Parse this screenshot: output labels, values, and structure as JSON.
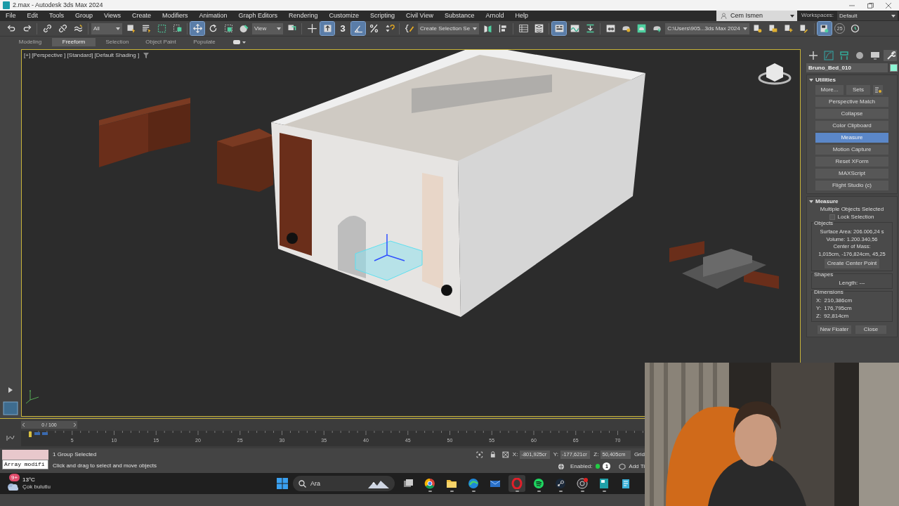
{
  "window": {
    "title": "2.max - Autodesk 3ds Max 2024"
  },
  "menu_bar": [
    "File",
    "Edit",
    "Tools",
    "Group",
    "Views",
    "Create",
    "Modifiers",
    "Animation",
    "Graph Editors",
    "Rendering",
    "Customize",
    "Scripting",
    "Civil View",
    "Substance",
    "Arnold",
    "Help"
  ],
  "user": {
    "name": "Cem Ismen"
  },
  "workspaces": {
    "label": "Workspaces:",
    "value": "Default"
  },
  "toolbar": [
    {
      "kind": "undo",
      "selected": false
    },
    {
      "kind": "redo",
      "selected": false
    },
    {
      "kind": "separator"
    },
    {
      "kind": "link",
      "selected": false
    },
    {
      "kind": "unlink",
      "selected": false
    },
    {
      "kind": "bind",
      "selected": false
    },
    {
      "kind": "separator"
    },
    {
      "kind": "dropdown",
      "value": "All"
    },
    {
      "kind": "select",
      "selected": false
    },
    {
      "kind": "select-by-name",
      "selected": false
    },
    {
      "kind": "region",
      "selected": false
    },
    {
      "kind": "crossing",
      "selected": false
    },
    {
      "kind": "separator"
    },
    {
      "kind": "move",
      "selected": true
    },
    {
      "kind": "rotate",
      "selected": false
    },
    {
      "kind": "scale",
      "selected": false
    },
    {
      "kind": "place",
      "selected": false
    },
    {
      "kind": "dropdown",
      "value": "View"
    },
    {
      "kind": "pivot",
      "selected": false
    },
    {
      "kind": "separator"
    },
    {
      "kind": "manipulate",
      "selected": false
    },
    {
      "kind": "keyboard",
      "selected": true
    },
    {
      "kind": "snap",
      "label": "3",
      "selected": false
    },
    {
      "kind": "angle-snap",
      "selected": true
    },
    {
      "kind": "percent-snap",
      "selected": false
    },
    {
      "kind": "spinner-snap",
      "selected": false
    },
    {
      "kind": "separator"
    },
    {
      "kind": "named-sets",
      "selected": false
    },
    {
      "kind": "dropdown",
      "value": "Create Selection Se"
    },
    {
      "kind": "mirror",
      "selected": false
    },
    {
      "kind": "align",
      "selected": false
    },
    {
      "kind": "separator"
    },
    {
      "kind": "explorer",
      "selected": false
    },
    {
      "kind": "layers",
      "selected": false
    },
    {
      "kind": "separator"
    },
    {
      "kind": "ribbon",
      "selected": true
    },
    {
      "kind": "curve-editor",
      "selected": false
    },
    {
      "kind": "schematic",
      "selected": false
    },
    {
      "kind": "separator"
    },
    {
      "kind": "material",
      "selected": false
    },
    {
      "kind": "render-setup",
      "selected": false
    },
    {
      "kind": "render-frame",
      "selected": false
    },
    {
      "kind": "render",
      "selected": false
    },
    {
      "kind": "dropdown",
      "value": "C:\\Users\\905...3ds Max 2024"
    },
    {
      "kind": "project",
      "selected": false
    },
    {
      "kind": "project-open",
      "selected": false
    },
    {
      "kind": "project-new",
      "selected": false
    },
    {
      "kind": "project-edit",
      "selected": false
    },
    {
      "kind": "separator"
    },
    {
      "kind": "autobackup",
      "selected": true
    },
    {
      "kind": "counter",
      "label": "25",
      "selected": false
    },
    {
      "kind": "history",
      "selected": false
    }
  ],
  "ribbon_tabs": [
    {
      "label": "Modeling",
      "selected": false
    },
    {
      "label": "Freeform",
      "selected": true
    },
    {
      "label": "Selection",
      "selected": false
    },
    {
      "label": "Object Paint",
      "selected": false
    },
    {
      "label": "Populate",
      "selected": false
    }
  ],
  "viewport": {
    "labels": [
      "[+]",
      "[Perspective ]",
      "[Standard]",
      "[Default Shading ]"
    ]
  },
  "command_panel": {
    "tabs": [
      {
        "kind": "create",
        "selected": false
      },
      {
        "kind": "modify",
        "selected": false
      },
      {
        "kind": "hierarchy",
        "selected": false
      },
      {
        "kind": "motion",
        "selected": false
      },
      {
        "kind": "display",
        "selected": false
      },
      {
        "kind": "utilities",
        "selected": true
      }
    ],
    "object_name": "Bruno_Bed_010",
    "color": "#8ef5d4",
    "utilities": {
      "title": "Utilities",
      "more": "More...",
      "sets": "Sets",
      "buttons": [
        {
          "label": "Perspective Match",
          "selected": false
        },
        {
          "label": "Collapse",
          "selected": false
        },
        {
          "label": "Color Clipboard",
          "selected": false
        },
        {
          "label": "Measure",
          "selected": true
        },
        {
          "label": "Motion Capture",
          "selected": false
        },
        {
          "label": "Reset XForm",
          "selected": false
        },
        {
          "label": "MAXScript",
          "selected": false
        },
        {
          "label": "Flight Studio (c)",
          "selected": false
        }
      ]
    },
    "measure": {
      "title": "Measure",
      "status": "Multiple Objects Selected",
      "lock_selection": {
        "label": "Lock Selection",
        "checked": false
      },
      "objects": {
        "title": "Objects",
        "lines": [
          "Surface Area: 206.006,24 s",
          "Volume: 1.200.340,56",
          "Center of Mass:",
          "1,015cm, -176,824cm, 45,25"
        ]
      },
      "create_center_point": "Create Center Point",
      "shapes": {
        "title": "Shapes",
        "length": "Length: ---"
      },
      "dimensions": {
        "title": "Dimensions",
        "lines": [
          {
            "axis": "X:",
            "value": "210,386cm"
          },
          {
            "axis": "Y:",
            "value": "176,795cm"
          },
          {
            "axis": "Z:",
            "value": "92,814cm"
          }
        ]
      },
      "new_floater": "New Floater",
      "close": "Close"
    }
  },
  "timeline": {
    "position": "0 / 100",
    "level": 0,
    "ticks": [
      "5",
      "10",
      "15",
      "20",
      "25",
      "30",
      "35",
      "40",
      "45",
      "50",
      "55",
      "60",
      "65",
      "70"
    ]
  },
  "status": {
    "listener": "Array modifi",
    "selection": "1 Group Selected",
    "prompt": "Click and drag to select and move objects",
    "coords": [
      {
        "axis": "X:",
        "value": "-801,925cr"
      },
      {
        "axis": "Y:",
        "value": "-177,621cr"
      },
      {
        "axis": "Z:",
        "value": "50,405cm"
      }
    ],
    "grid": "Grid",
    "enabled_label": "Enabled:",
    "enabled": true,
    "counter": "1",
    "add_time_tag": "Add Ti"
  },
  "taskbar": {
    "weather": {
      "badge": "9+",
      "temperature": "13°C",
      "condition": "Çok bulutlu"
    },
    "search": "Ara",
    "apps": [
      {
        "kind": "task-view",
        "selected": false,
        "running": false
      },
      {
        "kind": "chrome",
        "selected": false,
        "running": true
      },
      {
        "kind": "folder",
        "selected": false,
        "running": true
      },
      {
        "kind": "edge",
        "selected": false,
        "running": true
      },
      {
        "kind": "mail",
        "selected": false,
        "running": false
      },
      {
        "kind": "opera",
        "selected": true,
        "running": true
      },
      {
        "kind": "spotify",
        "selected": false,
        "running": true
      },
      {
        "kind": "steam",
        "selected": false,
        "running": true
      },
      {
        "kind": "obs",
        "selected": false,
        "running": true
      },
      {
        "kind": "max",
        "selected": false,
        "running": true
      },
      {
        "kind": "notepad",
        "selected": false,
        "running": false
      }
    ]
  }
}
